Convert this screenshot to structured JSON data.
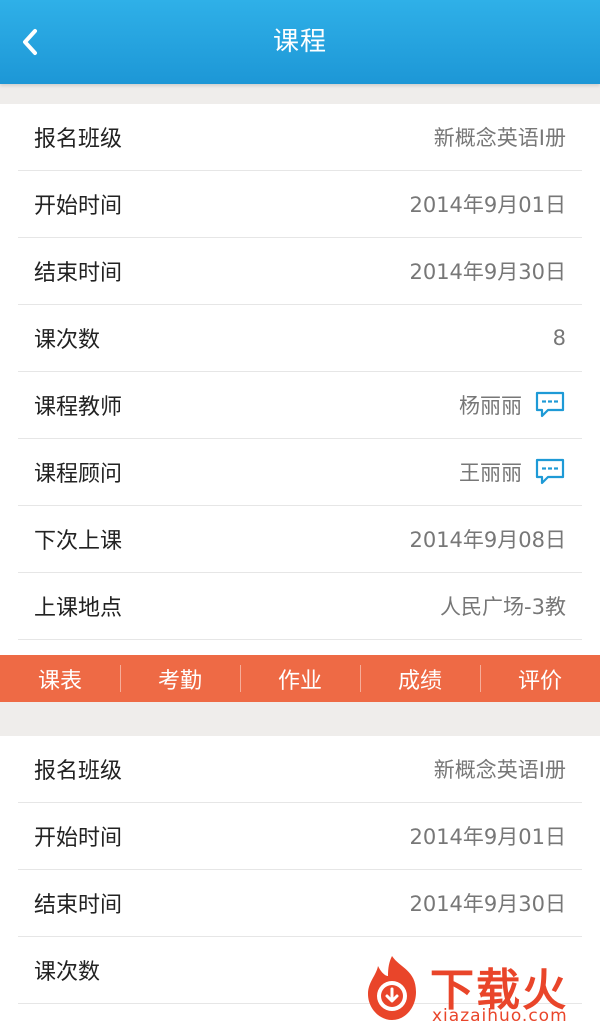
{
  "header": {
    "title": "课程",
    "back_icon": "chevron-left-icon"
  },
  "card1": {
    "rows": [
      {
        "label": "报名班级",
        "value": "新概念英语I册"
      },
      {
        "label": "开始时间",
        "value": "2014年9月01日"
      },
      {
        "label": "结束时间",
        "value": "2014年9月30日"
      },
      {
        "label": "课次数",
        "value": "8"
      },
      {
        "label": "课程教师",
        "value": "杨丽丽",
        "icon": "chat-bubble-icon"
      },
      {
        "label": "课程顾问",
        "value": "王丽丽",
        "icon": "chat-bubble-icon"
      },
      {
        "label": "下次上课",
        "value": "2014年9月08日"
      },
      {
        "label": "上课地点",
        "value": "人民广场-3教"
      }
    ]
  },
  "tabs": [
    "课表",
    "考勤",
    "作业",
    "成绩",
    "评价"
  ],
  "card2": {
    "rows": [
      {
        "label": "报名班级",
        "value": "新概念英语I册"
      },
      {
        "label": "开始时间",
        "value": "2014年9月01日"
      },
      {
        "label": "结束时间",
        "value": "2014年9月30日"
      },
      {
        "label": "课次数",
        "value": ""
      }
    ]
  },
  "watermark": {
    "brand": "下载火",
    "url": "xiazaihuo.com"
  },
  "colors": {
    "header": "#1d97d6",
    "tabbar": "#ee6a45",
    "icon_blue": "#1e9ad6",
    "background": "#efedeb",
    "watermark": "#e9452a"
  }
}
